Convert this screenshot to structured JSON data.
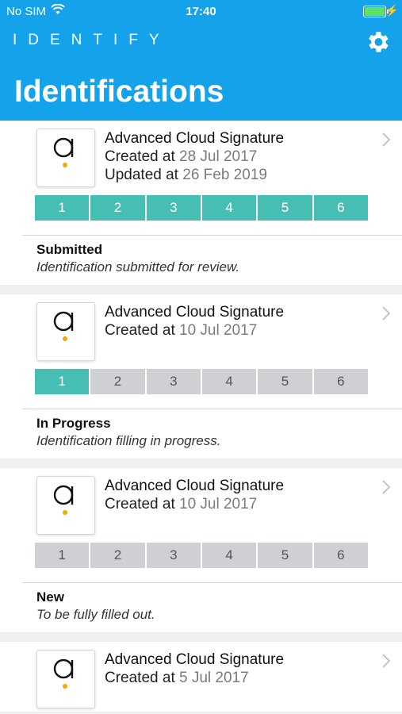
{
  "statusbar": {
    "carrier": "No SIM",
    "time": "17:40"
  },
  "header": {
    "logo": "IDENTIFY",
    "title": "Identifications"
  },
  "cards": [
    {
      "title": "Advanced Cloud Signature",
      "created_label": "Created at",
      "created": "28 Jul 2017",
      "updated_label": "Updated at",
      "updated": "26 Feb 2019",
      "steps": [
        "1",
        "2",
        "3",
        "4",
        "5",
        "6"
      ],
      "completed": 6,
      "status": "Submitted",
      "desc": "Identification submitted for review."
    },
    {
      "title": "Advanced Cloud Signature",
      "created_label": "Created at",
      "created": "10 Jul 2017",
      "steps": [
        "1",
        "2",
        "3",
        "4",
        "5",
        "6"
      ],
      "completed": 1,
      "status": "In Progress",
      "desc": "Identification filling in progress."
    },
    {
      "title": "Advanced Cloud Signature",
      "created_label": "Created at",
      "created": "10 Jul 2017",
      "steps": [
        "1",
        "2",
        "3",
        "4",
        "5",
        "6"
      ],
      "completed": 0,
      "status": "New",
      "desc": "To be fully filled out."
    },
    {
      "title": "Advanced Cloud Signature",
      "created_label": "Created at",
      "created": "5 Jul 2017"
    }
  ],
  "colors": {
    "header": "#14a3ea",
    "step_done": "#47beb4",
    "step_todo": "#cfd0d3",
    "dot": "#f2a900"
  }
}
